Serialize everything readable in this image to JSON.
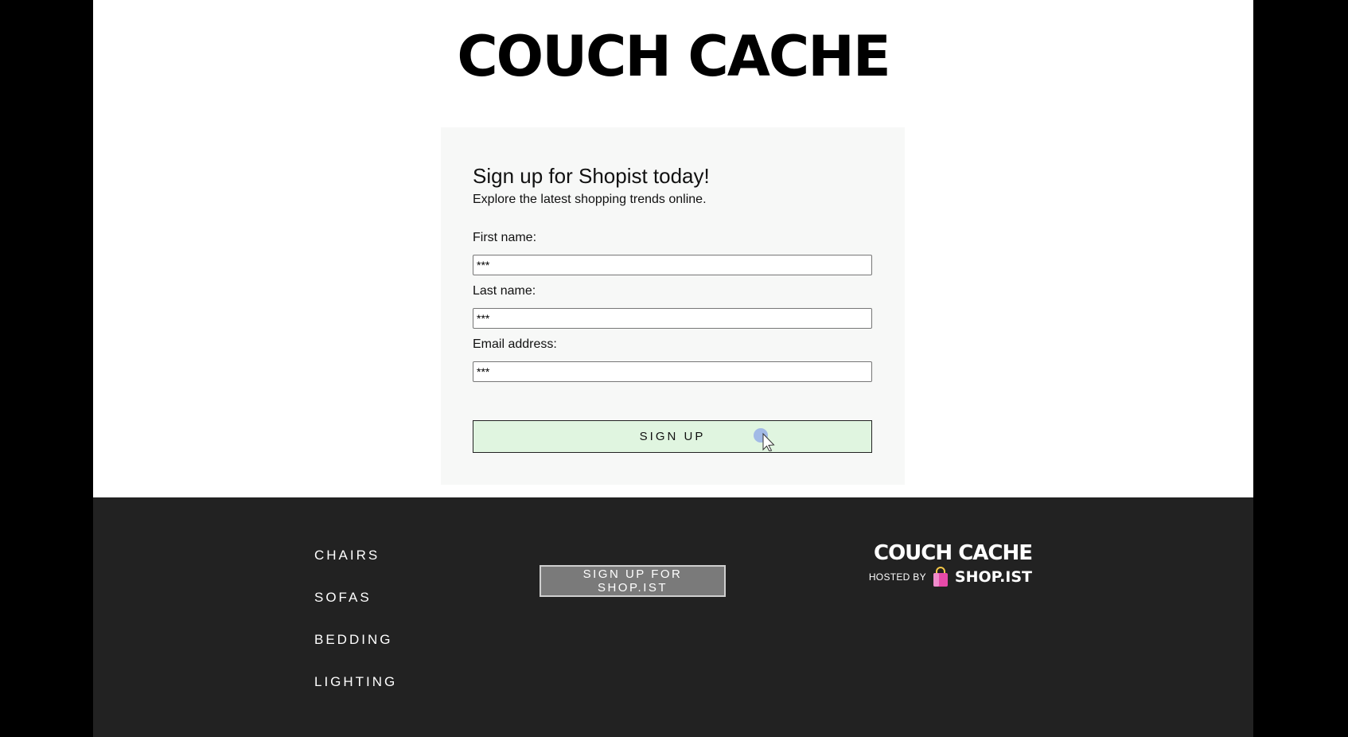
{
  "header": {
    "brand": "COUCH CACHE"
  },
  "signup_card": {
    "title": "Sign up for Shopist today!",
    "subtitle": "Explore the latest shopping trends online.",
    "fields": [
      {
        "label": "First name:",
        "value": "***"
      },
      {
        "label": "Last name:",
        "value": "***"
      },
      {
        "label": "Email address:",
        "value": "***"
      }
    ],
    "submit_label": "SIGN UP"
  },
  "footer": {
    "nav": [
      "CHAIRS",
      "SOFAS",
      "BEDDING",
      "LIGHTING"
    ],
    "signup_button": "SIGN UP FOR SHOP.IST",
    "brand": "COUCH CACHE",
    "hosted_by": "HOSTED BY",
    "host_name": "SHOP.IST"
  },
  "colors": {
    "submit_bg": "#e0f5e0",
    "footer_bg": "#222222",
    "bag_icon": "#e64aa8"
  },
  "icons": {
    "bag": "shopping-bag-icon",
    "cursor": "mouse-cursor-icon"
  }
}
